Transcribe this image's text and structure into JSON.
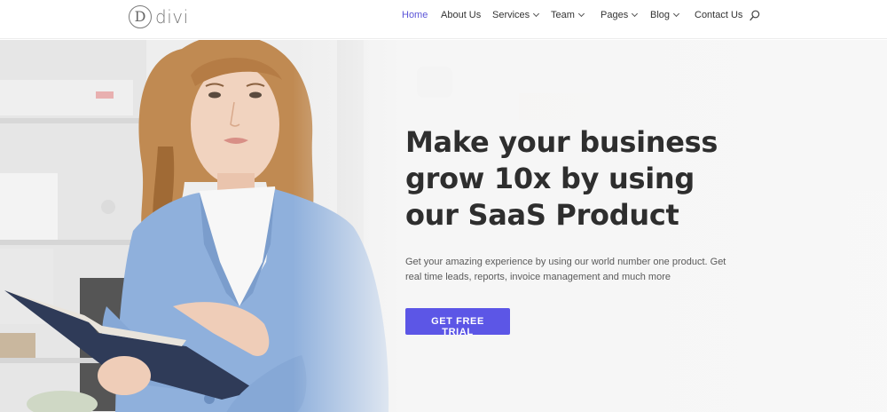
{
  "logo": {
    "letter": "D",
    "text": "divi"
  },
  "nav": {
    "items": [
      {
        "label": "Home",
        "active": true,
        "dropdown": false
      },
      {
        "label": "About Us",
        "active": false,
        "dropdown": false
      },
      {
        "label": "Services",
        "active": false,
        "dropdown": true
      },
      {
        "label": "Team",
        "active": false,
        "dropdown": true
      },
      {
        "label": "Pages",
        "active": false,
        "dropdown": true
      },
      {
        "label": "Blog",
        "active": false,
        "dropdown": true
      },
      {
        "label": "Contact Us",
        "active": false,
        "dropdown": false
      }
    ],
    "search_icon": "search-icon"
  },
  "hero": {
    "headline": "Make your business grow 10x by using our SaaS Product",
    "subtext": "Get your amazing experience by using our world number one product. Get real time leads, reports, invoice management and much more",
    "cta_label": "GET FREE TRIAL"
  },
  "colors": {
    "accent": "#5c56e6",
    "active_nav": "#5c56d8",
    "headline": "#2e2e2e",
    "body_text": "#5a5a5a"
  }
}
